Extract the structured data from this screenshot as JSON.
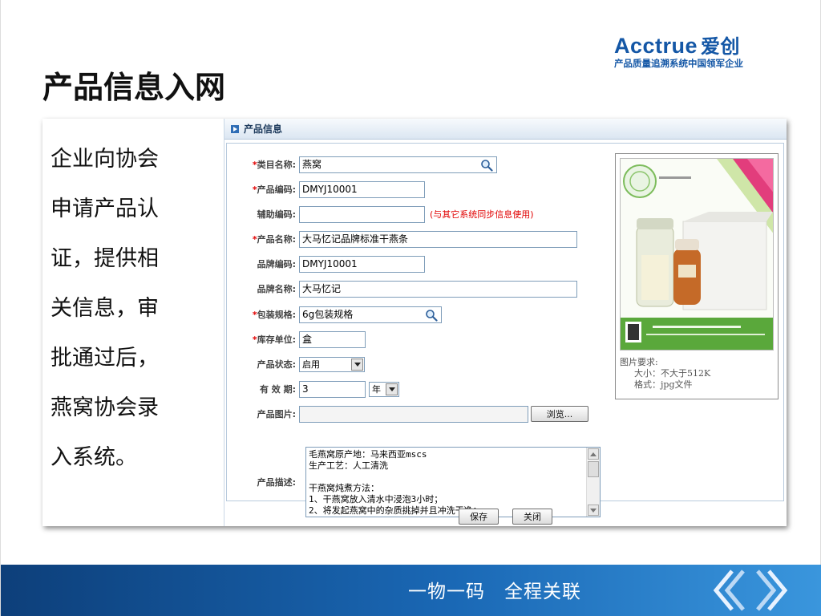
{
  "logo": {
    "brand": "Acctrue",
    "brand_cn": "爱创",
    "tagline": "产品质量追溯系统中国领军企业"
  },
  "title": "产品信息入网",
  "left_text": [
    "企业向协会",
    "申请产品认",
    "证，提供相",
    "关信息，审",
    "批通过后，",
    "燕窝协会录",
    "入系统。"
  ],
  "panel": {
    "header": "产品信息"
  },
  "form": {
    "category": {
      "label": "类目名称:",
      "value": "燕窝"
    },
    "product_code": {
      "label": "产品编码:",
      "value": "DMYJ10001"
    },
    "aux_code": {
      "label": "辅助编码:",
      "value": "",
      "note": "(与其它系统同步信息使用)"
    },
    "product_name": {
      "label": "产品名称:",
      "value": "大马忆记品牌标准干燕条"
    },
    "brand_code": {
      "label": "品牌编码:",
      "value": "DMYJ10001"
    },
    "brand_name": {
      "label": "品牌名称:",
      "value": "大马忆记"
    },
    "package_spec": {
      "label": "包装规格:",
      "value": "6g包装规格"
    },
    "stock_unit": {
      "label": "库存单位:",
      "value": "盒"
    },
    "status": {
      "label": "产品状态:",
      "value": "启用"
    },
    "validity": {
      "label": "有 效 期:",
      "value": "3",
      "unit": "年"
    },
    "image": {
      "label": "产品图片:",
      "browse": "浏览..."
    },
    "description": {
      "label": "产品描述:",
      "lines": [
        "毛燕窝原产地：马来西亚mscs",
        "生产工艺：人工清洗",
        "",
        "干燕窝炖煮方法：",
        "1、干燕窝放入清水中浸泡3小时；",
        "2、将发起燕窝中的杂质挑掉并且冲洗干净；"
      ]
    }
  },
  "image_requirements": {
    "title": "图片要求:",
    "size": "大小：不大于512K",
    "format": "格式：jpg文件"
  },
  "buttons": {
    "save": "保存",
    "close": "关闭"
  },
  "slogan": "一物一码　全程关联",
  "colors": {
    "brand_blue": "#1457a6",
    "required_red": "#e10000",
    "banner_dark": "#0d3f7a",
    "banner_light": "#3a96dd"
  }
}
